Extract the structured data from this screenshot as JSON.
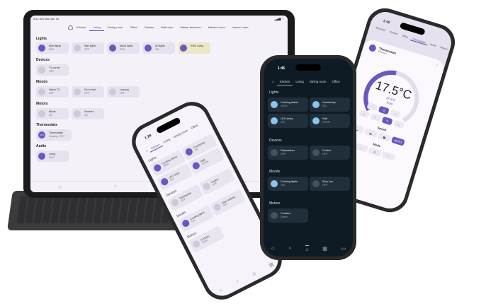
{
  "tablet": {
    "status_left": "9:41 AM  Mon Apr 16",
    "tabs": [
      "Kitchen",
      "Living",
      "Dining room",
      "Office",
      "Garden",
      "Bathroom",
      "Master bedroom",
      "Martin's room",
      "James' room"
    ],
    "active_tab": 1,
    "sections": {
      "lights": "Lights",
      "devices": "Devices",
      "moods": "Moods",
      "motors": "Motors",
      "thermostats": "Thermostats",
      "audio": "Audio"
    },
    "lights": [
      {
        "name": "Main lights",
        "state": "60%"
      },
      {
        "name": "Wall lights",
        "state": "OFF"
      },
      {
        "name": "Mood lights",
        "state": "30%"
      },
      {
        "name": "Art lights",
        "state": "ON"
      },
      {
        "name": "RGB Living",
        "state": ""
      }
    ],
    "devices": [
      {
        "name": "TV corner",
        "state": "OFF"
      }
    ],
    "moods": [
      {
        "name": "Watch TV",
        "state": "OFF"
      },
      {
        "name": "Go to bed",
        "state": "OFF"
      },
      {
        "name": "Leaving",
        "state": "OFF"
      }
    ],
    "motors": [
      {
        "name": "Blinds",
        "state": "Up"
      },
      {
        "name": "Shutters",
        "state": "Up"
      }
    ],
    "thermostats": [
      {
        "name": "Thermostats",
        "state": "Heating 17.5°"
      }
    ],
    "audio": [
      {
        "name": "Living",
        "state": "FMC"
      }
    ],
    "thermo_badge": "17.5"
  },
  "dark_phone": {
    "time": "1:46",
    "tabs": [
      "Kitchen",
      "Living",
      "Dining room",
      "Office"
    ],
    "active_tab": 0,
    "sections": {
      "lights": "Lights",
      "devices": "Devices",
      "moods": "Moods",
      "motors": "Motors"
    },
    "lights": [
      {
        "name": "Cooking island",
        "state": "100%"
      },
      {
        "name": "Countertop",
        "state": "ON"
      },
      {
        "name": "LED strips",
        "state": "ON"
      },
      {
        "name": "Wall",
        "state": "4700K"
      }
    ],
    "devices": [
      {
        "name": "Dishwasher",
        "state": "OFF"
      },
      {
        "name": "Cooker",
        "state": "OFF"
      }
    ],
    "moods": [
      {
        "name": "Cooking lights",
        "state": "ON"
      },
      {
        "name": "Stop coo",
        "state": "OFF"
      }
    ],
    "motors": [
      {
        "name": "Curtains",
        "state": "Down"
      }
    ]
  },
  "light_phone": {
    "time": "1:28",
    "tabs": [
      "Kitchen",
      "Living",
      "Dining room",
      "Office"
    ],
    "active_tab": 0,
    "sections": {
      "lights": "Lights",
      "devices": "Devices",
      "moods": "Moods",
      "motors": "Motors"
    },
    "lights": [
      {
        "name": "Cooking island",
        "state": "100%"
      },
      {
        "name": "Countertop",
        "state": "ON"
      },
      {
        "name": "LED strips",
        "state": "ON"
      },
      {
        "name": "Wall",
        "state": "4700K"
      }
    ],
    "devices": [
      {
        "name": "Dishwasher",
        "state": "OFF"
      },
      {
        "name": "Cooker",
        "state": "OFF"
      }
    ],
    "moods": [
      {
        "name": "Cooking lights",
        "state": "ON"
      },
      {
        "name": "Stop cooking",
        "state": "OFF"
      }
    ],
    "motors": [
      {
        "name": "Curtains",
        "state": "Down"
      }
    ]
  },
  "thermo_phone": {
    "time": "1:40",
    "tabs": [
      "Bedroom",
      "Garden",
      "Office",
      "Thermostats",
      "Audio",
      "Motors"
    ],
    "active_tab": 3,
    "sheet_title": "Thermostats",
    "sheet_sub": "Kitchen",
    "target_temp": "17.5°C",
    "current_temp": "27.5°C",
    "mode_state": "Auto",
    "speed_label": "Speed",
    "speed_options": [
      "",
      "",
      "",
      "AUTO"
    ],
    "mode_label": "Mode",
    "active_color": "#6a58c2"
  },
  "colors": {
    "accent": "#6a58c2",
    "dark_bg": "#0f1b24",
    "dark_card": "#1f2f3b",
    "light_blue": "#8ec3ec"
  }
}
